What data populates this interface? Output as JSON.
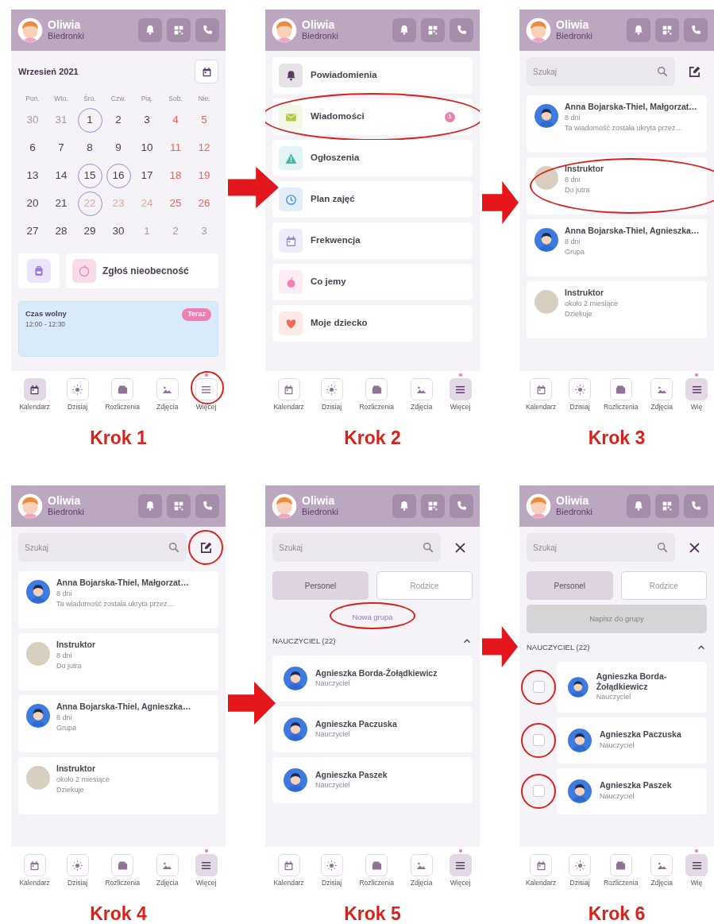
{
  "steps": [
    {
      "caption": "Krok 1",
      "screen": {
        "kind": "calendar",
        "header": {
          "name": "Oliwia",
          "group": "Biedronki"
        },
        "month": "Wrzesień 2021",
        "weekdays": [
          "Pon.",
          "Wto.",
          "Śro.",
          "Czw.",
          "Pią.",
          "Sob.",
          "Nie."
        ],
        "weeks": [
          [
            {
              "day": "30",
              "kind": "muted",
              "circled": false
            },
            {
              "day": "31",
              "kind": "muted",
              "circled": false
            },
            {
              "day": "1",
              "kind": "normal",
              "circled": true
            },
            {
              "day": "2",
              "kind": "normal",
              "circled": false
            },
            {
              "day": "3",
              "kind": "normal",
              "circled": false
            },
            {
              "day": "4",
              "kind": "weekend",
              "circled": false
            },
            {
              "day": "5",
              "kind": "weekend",
              "circled": false
            }
          ],
          [
            {
              "day": "6",
              "kind": "normal",
              "circled": false
            },
            {
              "day": "7",
              "kind": "normal",
              "circled": false
            },
            {
              "day": "8",
              "kind": "normal",
              "circled": false
            },
            {
              "day": "9",
              "kind": "normal",
              "circled": false
            },
            {
              "day": "10",
              "kind": "normal",
              "circled": false
            },
            {
              "day": "11",
              "kind": "weekend",
              "circled": false
            },
            {
              "day": "12",
              "kind": "weekend",
              "circled": false
            }
          ],
          [
            {
              "day": "13",
              "kind": "normal",
              "circled": false
            },
            {
              "day": "14",
              "kind": "normal",
              "circled": false
            },
            {
              "day": "15",
              "kind": "normal",
              "circled": true
            },
            {
              "day": "16",
              "kind": "normal",
              "circled": true
            },
            {
              "day": "17",
              "kind": "normal",
              "circled": false
            },
            {
              "day": "18",
              "kind": "weekend",
              "circled": false
            },
            {
              "day": "19",
              "kind": "weekend",
              "circled": false
            }
          ],
          [
            {
              "day": "20",
              "kind": "normal",
              "circled": false
            },
            {
              "day": "21",
              "kind": "normal",
              "circled": false
            },
            {
              "day": "22",
              "kind": "faded",
              "circled": true
            },
            {
              "day": "23",
              "kind": "faded",
              "circled": false
            },
            {
              "day": "24",
              "kind": "faded",
              "circled": false
            },
            {
              "day": "25",
              "kind": "weekend",
              "circled": false
            },
            {
              "day": "26",
              "kind": "weekend",
              "circled": false
            }
          ],
          [
            {
              "day": "27",
              "kind": "normal",
              "circled": false
            },
            {
              "day": "28",
              "kind": "normal",
              "circled": false
            },
            {
              "day": "29",
              "kind": "normal",
              "circled": false
            },
            {
              "day": "30",
              "kind": "normal",
              "circled": false
            },
            {
              "day": "1",
              "kind": "muted",
              "circled": false
            },
            {
              "day": "2",
              "kind": "muted",
              "circled": false
            },
            {
              "day": "3",
              "kind": "muted",
              "circled": false
            }
          ]
        ],
        "absence_label": "Zgłoś nieobecność",
        "event": {
          "title": "Czas wolny",
          "time": "12:00 - 12:30",
          "badge": "Teraz"
        },
        "nav": [
          {
            "label": "Kalendarz",
            "selected": true,
            "dot": false,
            "highlighted": false
          },
          {
            "label": "Dzisiaj",
            "selected": false,
            "dot": false,
            "highlighted": false
          },
          {
            "label": "Rozliczenia",
            "selected": false,
            "dot": false,
            "highlighted": false
          },
          {
            "label": "Zdjęcia",
            "selected": false,
            "dot": false,
            "highlighted": false
          },
          {
            "label": "Więcej",
            "selected": false,
            "dot": true,
            "highlighted": true
          }
        ]
      }
    },
    {
      "caption": "Krok 2",
      "screen": {
        "kind": "menu",
        "header": {
          "name": "Oliwia",
          "group": "Biedronki"
        },
        "items": [
          {
            "label": "Powiadomienia",
            "color": "#5b3a63",
            "highlighted": false
          },
          {
            "label": "Wiadomości",
            "color": "#b5c74a",
            "badge": "1",
            "highlighted": true
          },
          {
            "label": "Ogłoszenia",
            "color": "#3fb8b0",
            "highlighted": false
          },
          {
            "label": "Plan zajęć",
            "color": "#4a8fe0",
            "highlighted": false
          },
          {
            "label": "Frekwencja",
            "color": "#9b86e0",
            "highlighted": false
          },
          {
            "label": "Co jemy",
            "color": "#f27fb5",
            "highlighted": false
          },
          {
            "label": "Moje dziecko",
            "color": "#f06a5a",
            "highlighted": false
          }
        ],
        "nav": [
          {
            "label": "Kalendarz",
            "selected": false,
            "dot": false,
            "highlighted": false
          },
          {
            "label": "Dzisiaj",
            "selected": false,
            "dot": false,
            "highlighted": false
          },
          {
            "label": "Rozliczenia",
            "selected": false,
            "dot": false,
            "highlighted": false
          },
          {
            "label": "Zdjęcia",
            "selected": false,
            "dot": false,
            "highlighted": false
          },
          {
            "label": "Więcej",
            "selected": true,
            "dot": true,
            "highlighted": false
          }
        ]
      }
    },
    {
      "caption": "Krok 3",
      "screen": {
        "kind": "messages",
        "header": {
          "name": "Oliwia",
          "group": "Biedronki"
        },
        "search": {
          "placeholder": "Szukaj"
        },
        "compose_highlighted": false,
        "conversations": [
          {
            "title": "Anna Bojarska-Thiel, Małgorzat…",
            "time": "8 dni",
            "preview": "Ta wiadomość została ukryta przez…",
            "kind": "cartoon",
            "highlighted": false
          },
          {
            "title": "Instruktor",
            "time": "8 dni",
            "preview": "Do jutra",
            "kind": "photo",
            "highlighted": true
          },
          {
            "title": "Anna Bojarska-Thiel, Agnieszka…",
            "time": "8 dni",
            "preview": "Grupa",
            "kind": "cartoon",
            "highlighted": false
          },
          {
            "title": "Instruktor",
            "time": "około 2 miesiące",
            "preview": "Dziekuje",
            "kind": "photo",
            "highlighted": false
          }
        ],
        "nav": [
          {
            "label": "Kalendarz",
            "selected": false,
            "dot": false,
            "highlighted": false
          },
          {
            "label": "Dzisiaj",
            "selected": false,
            "dot": false,
            "highlighted": false
          },
          {
            "label": "Rozliczenia",
            "selected": false,
            "dot": false,
            "highlighted": false
          },
          {
            "label": "Zdjęcia",
            "selected": false,
            "dot": false,
            "highlighted": false
          },
          {
            "label": "Wię",
            "selected": true,
            "dot": true,
            "highlighted": false
          }
        ]
      }
    },
    {
      "caption": "Krok 4",
      "screen": {
        "kind": "messages",
        "header": {
          "name": "Oliwia",
          "group": "Biedronki"
        },
        "search": {
          "placeholder": "Szukaj"
        },
        "compose_highlighted": true,
        "conversations": [
          {
            "title": "Anna Bojarska-Thiel, Małgorzat…",
            "time": "8 dni",
            "preview": "Ta wiadomość została ukryta przez…",
            "kind": "cartoon",
            "highlighted": false
          },
          {
            "title": "Instruktor",
            "time": "8 dni",
            "preview": "Do jutra",
            "kind": "photo",
            "highlighted": false
          },
          {
            "title": "Anna Bojarska-Thiel, Agnieszka…",
            "time": "8 dni",
            "preview": "Grupa",
            "kind": "cartoon",
            "highlighted": false
          },
          {
            "title": "Instruktor",
            "time": "około 2 miesiące",
            "preview": "Dziekuje",
            "kind": "photo",
            "highlighted": false
          }
        ],
        "nav": [
          {
            "label": "Kalendarz",
            "selected": false,
            "dot": false,
            "highlighted": false
          },
          {
            "label": "Dzisiaj",
            "selected": false,
            "dot": false,
            "highlighted": false
          },
          {
            "label": "Rozliczenia",
            "selected": false,
            "dot": false,
            "highlighted": false
          },
          {
            "label": "Zdjęcia",
            "selected": false,
            "dot": false,
            "highlighted": false
          },
          {
            "label": "Więcej",
            "selected": true,
            "dot": true,
            "highlighted": false
          }
        ]
      }
    },
    {
      "caption": "Krok 5",
      "screen": {
        "kind": "contacts",
        "header": {
          "name": "Oliwia",
          "group": "Biedronki"
        },
        "search": {
          "placeholder": "Szukaj"
        },
        "tabs": [
          {
            "label": "Personel",
            "selected": true
          },
          {
            "label": "Rodzice",
            "selected": false
          }
        ],
        "new_group": {
          "label": "Nowa grupa",
          "highlighted": true
        },
        "section": {
          "title": "NAUCZYCIEL (22)",
          "expanded": true
        },
        "contacts": [
          {
            "name": "Agnieszka Borda-Żołądkiewicz",
            "role": "Nauczyciel"
          },
          {
            "name": "Agnieszka Paczuska",
            "role": "Nauczyciel"
          },
          {
            "name": "Agnieszka Paszek",
            "role": "Nauczyciel"
          }
        ],
        "nav": [
          {
            "label": "Kalendarz",
            "selected": false,
            "dot": false,
            "highlighted": false
          },
          {
            "label": "Dzisiaj",
            "selected": false,
            "dot": false,
            "highlighted": false
          },
          {
            "label": "Rozliczenia",
            "selected": false,
            "dot": false,
            "highlighted": false
          },
          {
            "label": "Zdjęcia",
            "selected": false,
            "dot": false,
            "highlighted": false
          },
          {
            "label": "Więcej",
            "selected": true,
            "dot": true,
            "highlighted": false
          }
        ]
      }
    },
    {
      "caption": "Krok 6",
      "screen": {
        "kind": "contacts",
        "header": {
          "name": "Oliwia",
          "group": "Biedronki"
        },
        "search": {
          "placeholder": "Szukaj"
        },
        "tabs": [
          {
            "label": "Personel",
            "selected": true
          },
          {
            "label": "Rodzice",
            "selected": false
          }
        ],
        "group_button": {
          "label": "Napisz do grupy",
          "disabled": true
        },
        "section": {
          "title": "NAUCZYCIEL (22)",
          "expanded": true
        },
        "contacts": [
          {
            "name": "Agnieszka Borda-Żołądkiewicz",
            "role": "Nauczyciel",
            "checked": false,
            "highlighted": true
          },
          {
            "name": "Agnieszka Paczuska",
            "role": "Nauczyciel",
            "checked": false,
            "highlighted": true
          },
          {
            "name": "Agnieszka Paszek",
            "role": "Nauczyciel",
            "checked": false,
            "highlighted": true
          }
        ],
        "nav": [
          {
            "label": "Kalendarz",
            "selected": false,
            "dot": false,
            "highlighted": false
          },
          {
            "label": "Dzisiaj",
            "selected": false,
            "dot": false,
            "highlighted": false
          },
          {
            "label": "Rozliczenia",
            "selected": false,
            "dot": false,
            "highlighted": false
          },
          {
            "label": "Zdjęcia",
            "selected": false,
            "dot": false,
            "highlighted": false
          },
          {
            "label": "Wię",
            "selected": true,
            "dot": true,
            "highlighted": false
          }
        ]
      }
    }
  ]
}
